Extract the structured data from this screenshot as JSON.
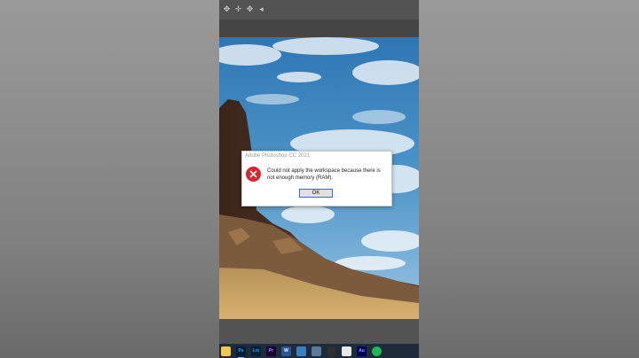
{
  "dialog": {
    "title": "Adobe Photoshop CC 2021",
    "message": "Could not apply the workspace because there is not enough memory (RAM).",
    "ok_label": "OK",
    "icon": "error-icon",
    "error_color": "#d8262e"
  },
  "taskbar": {
    "apps": [
      {
        "name": "file-explorer",
        "label": ""
      },
      {
        "name": "photoshop",
        "label": "Ps"
      },
      {
        "name": "lightroom-classic",
        "label": "Lrc"
      },
      {
        "name": "premiere-pro",
        "label": "Pr"
      },
      {
        "name": "word",
        "label": "W"
      },
      {
        "name": "photos",
        "label": ""
      },
      {
        "name": "image-viewer",
        "label": ""
      },
      {
        "name": "obs",
        "label": ""
      },
      {
        "name": "notepad",
        "label": ""
      },
      {
        "name": "audition",
        "label": "Au"
      },
      {
        "name": "spotify",
        "label": ""
      }
    ],
    "active_app": "photoshop"
  },
  "toolbar": {
    "icons": [
      "move-icon",
      "arrange-icon",
      "move-tool-icon",
      "arrow-icon"
    ]
  }
}
